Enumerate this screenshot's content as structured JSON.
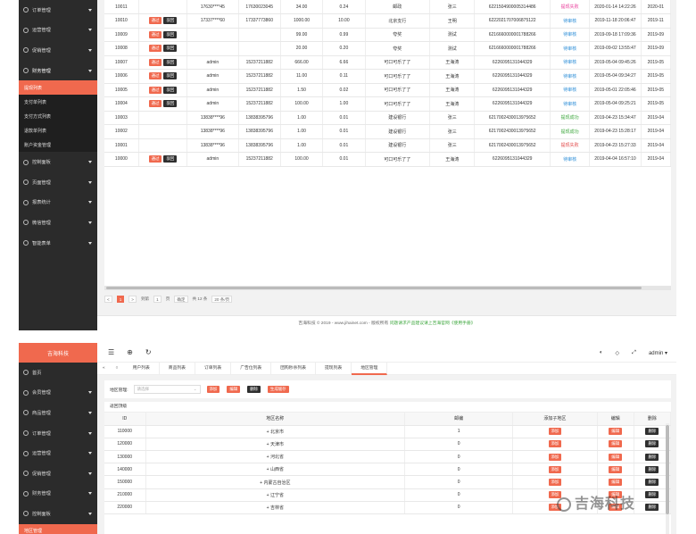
{
  "panel1": {
    "sidebar": {
      "top_items": [
        "订单管理",
        "运营管理",
        "促销管理"
      ],
      "active": "财务管理",
      "sub_items": [
        "提现列表",
        "支付单列表",
        "支付方式列表",
        "退款单列表",
        "账户资金管理"
      ],
      "bottom_items": [
        "控制面板",
        "页面管理",
        "报表统计",
        "微信管理",
        "智能表单"
      ]
    },
    "rows": [
      {
        "id": "10011",
        "b1": "",
        "b2": "",
        "user": "17630****45",
        "phone": "17630023045",
        "amount": "34.00",
        "fee": "0.24",
        "bank": "邮政",
        "name": "张三",
        "card": "6221504900005314486",
        "status": "提现失败",
        "status_cls": "st-pink",
        "time": "2020-01-14 14:22:26",
        "time2": "2020-01"
      },
      {
        "id": "10010",
        "b1": "通过",
        "b2": "驳回",
        "user": "17337****60",
        "phone": "17337773860",
        "amount": "1000.00",
        "fee": "10.00",
        "bank": "北京支行",
        "name": "王明",
        "card": "6222021707006875122",
        "status": "待审核",
        "status_cls": "st-blue",
        "time": "2019-11-18 20:06:47",
        "time2": "2019-11"
      },
      {
        "id": "10009",
        "b1": "通过",
        "b2": "驳回",
        "user": "",
        "phone": "",
        "amount": "99.00",
        "fee": "0.99",
        "bank": "夸奖",
        "name": "测试",
        "card": "6216660000001788266",
        "status": "待审核",
        "status_cls": "st-blue",
        "time": "2019-09-18 17:09:36",
        "time2": "2019-09"
      },
      {
        "id": "10008",
        "b1": "通过",
        "b2": "驳回",
        "user": "",
        "phone": "",
        "amount": "20.00",
        "fee": "0.20",
        "bank": "夸奖",
        "name": "测试",
        "card": "6216660000001788266",
        "status": "待审核",
        "status_cls": "st-blue",
        "time": "2019-09-02 13:55:47",
        "time2": "2019-09"
      },
      {
        "id": "10007",
        "b1": "通过",
        "b2": "驳回",
        "user": "admin",
        "phone": "15237211882",
        "amount": "666.00",
        "fee": "6.66",
        "bank": "可口可乐了了",
        "name": "王海涛",
        "card": "6226095131044329",
        "status": "待审核",
        "status_cls": "st-blue",
        "time": "2019-05-04 09:45:26",
        "time2": "2019-05"
      },
      {
        "id": "10006",
        "b1": "通过",
        "b2": "驳回",
        "user": "admin",
        "phone": "15237211882",
        "amount": "11.00",
        "fee": "0.11",
        "bank": "可口可乐了了",
        "name": "王海涛",
        "card": "6226095131044329",
        "status": "待审核",
        "status_cls": "st-blue",
        "time": "2019-05-04 09:34:27",
        "time2": "2019-05"
      },
      {
        "id": "10005",
        "b1": "通过",
        "b2": "驳回",
        "user": "admin",
        "phone": "15237211882",
        "amount": "1.50",
        "fee": "0.02",
        "bank": "可口可乐了了",
        "name": "王海涛",
        "card": "6226095131044329",
        "status": "待审核",
        "status_cls": "st-blue",
        "time": "2019-05-01 22:05:46",
        "time2": "2019-05"
      },
      {
        "id": "10004",
        "b1": "通过",
        "b2": "驳回",
        "user": "admin",
        "phone": "15237211882",
        "amount": "100.00",
        "fee": "1.00",
        "bank": "可口可乐了了",
        "name": "王海涛",
        "card": "6226095131044329",
        "status": "待审核",
        "status_cls": "st-blue",
        "time": "2019-05-04 09:25:21",
        "time2": "2019-05"
      },
      {
        "id": "10003",
        "b1": "",
        "b2": "",
        "user": "13838****96",
        "phone": "13838395796",
        "amount": "1.00",
        "fee": "0.01",
        "bank": "建设银行",
        "name": "张三",
        "card": "6217002430013975652",
        "status": "提现成功",
        "status_cls": "st-green",
        "time": "2019-04-23 15:34:47",
        "time2": "2019-04"
      },
      {
        "id": "10002",
        "b1": "",
        "b2": "",
        "user": "13838****96",
        "phone": "13838395796",
        "amount": "1.00",
        "fee": "0.01",
        "bank": "建设银行",
        "name": "张三",
        "card": "6217002430013975652",
        "status": "提现成功",
        "status_cls": "st-green",
        "time": "2019-04-23 15:28:17",
        "time2": "2019-04"
      },
      {
        "id": "10001",
        "b1": "",
        "b2": "",
        "user": "13838****96",
        "phone": "13838395796",
        "amount": "1.00",
        "fee": "0.01",
        "bank": "建设银行",
        "name": "张三",
        "card": "6217002430013975652",
        "status": "提现失败",
        "status_cls": "st-red",
        "time": "2019-04-23 15:27:33",
        "time2": "2019-04"
      },
      {
        "id": "10000",
        "b1": "通过",
        "b2": "驳回",
        "user": "admin",
        "phone": "15237211882",
        "amount": "100.00",
        "fee": "0.01",
        "bank": "可口可乐了了",
        "name": "王海涛",
        "card": "6226095131044329",
        "status": "待审核",
        "status_cls": "st-blue",
        "time": "2019-04-04 16:57:10",
        "time2": "2019-04"
      }
    ],
    "pager": {
      "prev": "<",
      "page": "1",
      "next": ">",
      "goto": "到第",
      "goto_val": "1",
      "page_unit": "页",
      "confirm": "确定",
      "total": "共 12 条",
      "per_page": "20 条/页"
    },
    "footer": {
      "prefix": "吉海科技 © 2019 - www.jihainet.com - 版权所有",
      "link": "问题请求产品建议请上吉海官网《使用手册》"
    }
  },
  "panel2": {
    "logo": "吉海科技",
    "user": "admin",
    "sidebar": {
      "items": [
        "首页",
        "会员管理",
        "商品管理",
        "订单管理",
        "运营管理",
        "促销管理",
        "财务管理",
        "控制面板"
      ],
      "sub": "地区管理"
    },
    "tabs": [
      "用户列表",
      "商品列表",
      "订单列表",
      "广告位列表",
      "团购秒杀列表",
      "提现列表",
      "地区管理"
    ],
    "toolbar": {
      "label": "地区管理:",
      "placeholder": "请选择",
      "add": "添加",
      "edit": "编辑",
      "del": "删除",
      "gen": "生成缓存"
    },
    "back": "返回顶级",
    "headers": [
      "ID",
      "地区名称",
      "邮编",
      "添加子地区",
      "编辑",
      "删除"
    ],
    "rows": [
      {
        "id": "110000",
        "name": "北京市",
        "zip": "1"
      },
      {
        "id": "120000",
        "name": "天津市",
        "zip": "0"
      },
      {
        "id": "130000",
        "name": "河北省",
        "zip": "0"
      },
      {
        "id": "140000",
        "name": "山西省",
        "zip": "0"
      },
      {
        "id": "150000",
        "name": "内蒙古自治区",
        "zip": "0"
      },
      {
        "id": "210000",
        "name": "辽宁省",
        "zip": "0"
      },
      {
        "id": "220000",
        "name": "吉林省",
        "zip": "0"
      }
    ],
    "row_btn": {
      "add": "添加",
      "edit": "编辑",
      "del": "删除"
    }
  },
  "watermark": "吉海科技"
}
